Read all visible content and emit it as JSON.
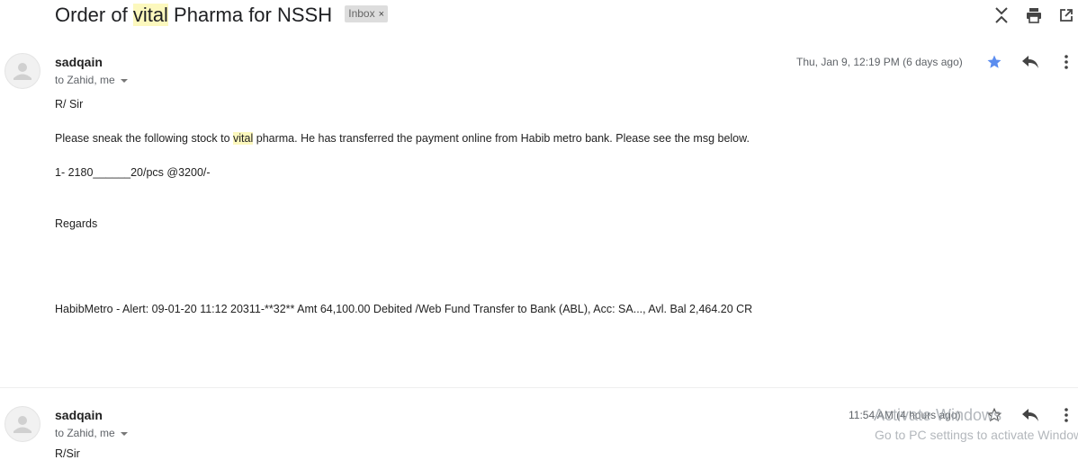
{
  "subject": {
    "part1": "Order of ",
    "highlight": "vital",
    "part2": " Pharma for NSSH",
    "label": "Inbox",
    "label_close": "×"
  },
  "header_icons": [
    "collapse-all-icon",
    "print-icon",
    "open-in-new-window-icon"
  ],
  "messages": [
    {
      "sender": "sadqain",
      "to": "to Zahid, me",
      "date": "Thu, Jan 9, 12:19 PM (6 days ago)",
      "starred": true,
      "body": {
        "greeting": "R/ Sir",
        "line1_a": "Please  sneak the following stock to ",
        "line1_hl": "vital",
        "line1_b": " pharma. He has transferred the payment online from Habib metro bank. Please see the msg below.",
        "item": "1-   2180______20/pcs @3200/-",
        "regards": "Regards",
        "alert": "HabibMetro - Alert: 09-01-20 11:12 20311-**32** Amt 64,100.00 Debited /Web Fund Transfer to Bank (ABL), Acc: SA..., Avl. Bal 2,464.20 CR"
      }
    },
    {
      "sender": "sadqain",
      "to": "to Zahid, me",
      "date": "11:54 AM (4 hours ago)",
      "starred": false,
      "body": {
        "greeting": "R/Sir"
      }
    }
  ],
  "watermark": {
    "title": "Activate Windows",
    "subtitle": "Go to PC settings to activate Windows."
  },
  "colors": {
    "star_active": "#5b8def",
    "highlight": "#fcf8bd"
  }
}
